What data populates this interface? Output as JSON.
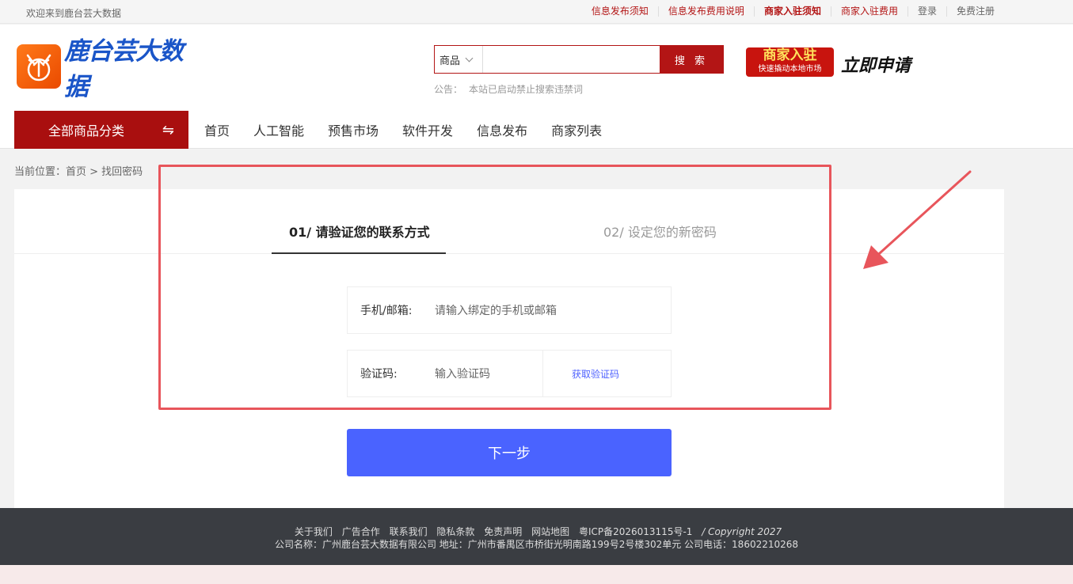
{
  "topbar": {
    "welcome": "欢迎来到鹿台芸大数据",
    "links": [
      "信息发布须知",
      "信息发布费用说明",
      "商家入驻须知",
      "商家入驻费用",
      "登录",
      "免费注册"
    ]
  },
  "header": {
    "logo_text": "鹿台芸大数据",
    "search": {
      "category": "商品",
      "placeholder": "",
      "button": "搜 索"
    },
    "notice_label": "公告：",
    "notice_text": "本站已启动禁止搜索违禁词",
    "merchant_badge_title": "商家入驻",
    "merchant_badge_sub": "快速撬动本地市场",
    "apply_now": "立即申请"
  },
  "nav": {
    "all_categories": "全部商品分类",
    "swap_icon": "⇋",
    "items": [
      "首页",
      "人工智能",
      "预售市场",
      "软件开发",
      "信息发布",
      "商家列表"
    ]
  },
  "breadcrumb": "当前位置：首页 > 找回密码",
  "form": {
    "step1": "01/ 请验证您的联系方式",
    "step2": "02/ 设定您的新密码",
    "contact_label": "手机/邮箱:",
    "contact_placeholder": "请输入绑定的手机或邮箱",
    "code_label": "验证码:",
    "code_placeholder": "输入验证码",
    "get_code": "获取验证码",
    "next": "下一步"
  },
  "footer": {
    "links": [
      "关于我们",
      "广告合作",
      "联系我们",
      "隐私条款",
      "免责声明",
      "网站地图",
      "粤ICP备2026013115号-1"
    ],
    "copyright": "/ Copyright 2027",
    "company_line": "公司名称：广州鹿台芸大数据有限公司   地址：广州市番禺区市桥街光明南路199号2号楼302单元 公司电话：18602210268"
  },
  "colors": {
    "brand_red": "#b31515",
    "primary_blue": "#4a63ff",
    "annotation_red": "#e8555b"
  }
}
